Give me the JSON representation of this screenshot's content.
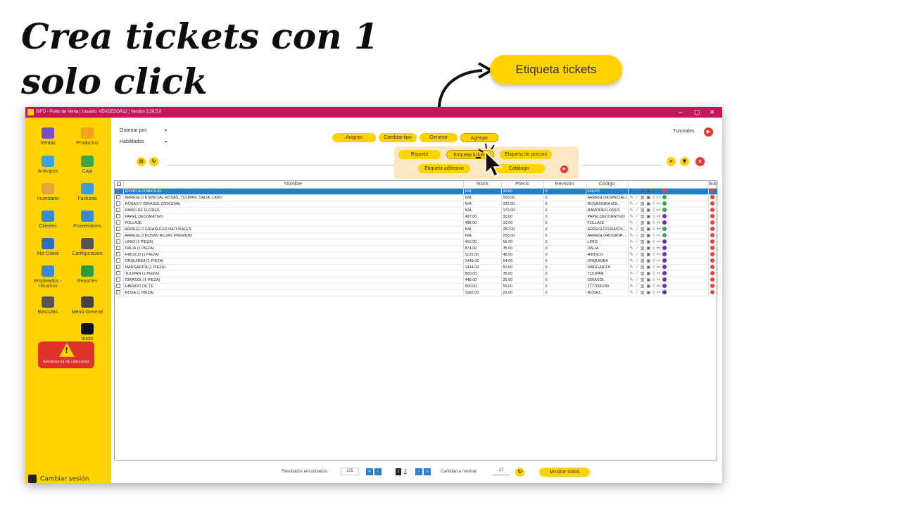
{
  "headline": "Crea tickets con 1 solo click",
  "callout": "Etiqueta tickets",
  "window": {
    "title": "SIFO - Punto de Venta    |  Usuario: VENDEDOR12 | Versión 3.20.5.0",
    "controls": [
      "–",
      "▢",
      "✕"
    ]
  },
  "sidebar": {
    "items": [
      {
        "label": "Ventas",
        "icon": "cash-register-icon",
        "color": "#7a4fc9"
      },
      {
        "label": "Productos",
        "icon": "box-icon",
        "color": "#f2a516"
      },
      {
        "label": "Anticipos",
        "icon": "money-hand-icon",
        "color": "#3aa3d8"
      },
      {
        "label": "Caja",
        "icon": "cash-icon",
        "color": "#3aa648"
      },
      {
        "label": "Inventario",
        "icon": "boxes-icon",
        "color": "#e8a33b"
      },
      {
        "label": "Facturas",
        "icon": "invoice-icon",
        "color": "#3d9ad8"
      },
      {
        "label": "Clientes",
        "icon": "client-icon",
        "color": "#3a8ad0"
      },
      {
        "label": "Proveedores",
        "icon": "truck-icon",
        "color": "#3a8ad0"
      },
      {
        "label": "Mis Datos",
        "icon": "user-icon",
        "color": "#2f6fc0"
      },
      {
        "label": "Configuración",
        "icon": "gear-icon",
        "color": "#555555"
      },
      {
        "label": "Empleados - Usuarios",
        "icon": "team-icon",
        "color": "#3a8ad0"
      },
      {
        "label": "Reportes",
        "icon": "chart-icon",
        "color": "#2c9b44"
      },
      {
        "label": "Básculas",
        "icon": "scale-icon",
        "color": "#555555"
      },
      {
        "label": "Menú General",
        "icon": "menu-icon",
        "color": "#444444"
      },
      {
        "label": "Inicio",
        "icon": "home-icon",
        "color": "#111111"
      }
    ],
    "warning": "Advertencia de caducidad",
    "logout": "Cambiar sesión"
  },
  "toolbar": {
    "ordenar": "Ordenar por:",
    "habilitados": "Habilitados",
    "asignar": "Asignar",
    "cambiar_tipo": "Cambiar tipo",
    "generar": "Generar",
    "agregar": "Agregar",
    "tutoriales": "Tutoriales"
  },
  "dropdown": {
    "reporte": "Reporte",
    "etiqueta_tickets": "Etiqueta tickets",
    "etiqueta_precios": "Etiqueta de precios",
    "etiqueta_adhesiva": "Etiqueta adhesiva",
    "catalogo": "Catálogo"
  },
  "table": {
    "headers": [
      "",
      "Nombre",
      "Stock",
      "Precio",
      "Revisión",
      "Código",
      "",
      "Sub"
    ],
    "rows": [
      {
        "nombre": "ENVIO A DOMICILIO",
        "stock": "N/A",
        "precio": "30.00",
        "revision": "0",
        "codigo": "ENVIO",
        "dot": "#e8423a",
        "tag": "#e8423a"
      },
      {
        "nombre": "ARREGLO ESPECIAL ROSAS, TULIPAN, DALIA, LIRIO",
        "stock": "N/A",
        "precio": "500.00",
        "revision": "0",
        "codigo": "ARREGLOESPECIAL1",
        "dot": "#e8423a",
        "tag": "#2fa84f"
      },
      {
        "nombre": "ROSAS Y GIRASOL (DOCENA)",
        "stock": "N/A",
        "precio": "322.00",
        "revision": "0",
        "codigo": "ROSASGIRASOL",
        "dot": "#e8423a",
        "tag": "#2fa84f"
      },
      {
        "nombre": "RAMO DE FLORES",
        "stock": "N/A",
        "precio": "170.00",
        "revision": "0",
        "codigo": "RAMODEFLORES",
        "dot": "#e8423a",
        "tag": "#2fa84f"
      },
      {
        "nombre": "PAPEL DECORATIVO",
        "stock": "497.00",
        "precio": "30.00",
        "revision": "0",
        "codigo": "PAPELDECORATIVO",
        "dot": "#e8423a",
        "tag": "#6a2fb0"
      },
      {
        "nombre": "FOLLAJE",
        "stock": "498.00",
        "precio": "10.00",
        "revision": "0",
        "codigo": "FOLLAJE",
        "dot": "#e8423a",
        "tag": "#6a2fb0"
      },
      {
        "nombre": "ARREGLO GIRASOLES NATURALES",
        "stock": "N/A",
        "precio": "250.00",
        "revision": "0",
        "codigo": "ARREGLOGIRASOL...",
        "dot": "#e8423a",
        "tag": "#2fa84f"
      },
      {
        "nombre": "ARREGLO ROSAS ROJAS PREMIUM",
        "stock": "N/A",
        "precio": "250.00",
        "revision": "0",
        "codigo": "ARREGLOROSASR...",
        "dot": "#e8423a",
        "tag": "#2fa84f"
      },
      {
        "nombre": "LIRIO (1 PIEZA)",
        "stock": "450.00",
        "precio": "55.00",
        "revision": "0",
        "codigo": "LIRIO",
        "dot": "#e8423a",
        "tag": "#6a2fb0"
      },
      {
        "nombre": "DALIA (1 PIEZA)",
        "stock": "874.00",
        "precio": "35.00",
        "revision": "0",
        "codigo": "DALIA",
        "dot": "#e8423a",
        "tag": "#6a2fb0"
      },
      {
        "nombre": "HIBISCO (1 PIEZA)",
        "stock": "1125.00",
        "precio": "48.00",
        "revision": "0",
        "codigo": "HIBISCO",
        "dot": "#e8423a",
        "tag": "#6a2fb0"
      },
      {
        "nombre": "ORQUIDEA (1 PIEZA)",
        "stock": "1445.00",
        "precio": "54.00",
        "revision": "0",
        "codigo": "ORQUIDEA",
        "dot": "#e8423a",
        "tag": "#6a2fb0"
      },
      {
        "nombre": "MARGARITA (1 PIEZA)",
        "stock": "1444.00",
        "precio": "50.00",
        "revision": "0",
        "codigo": "MARGARITA",
        "dot": "#e8423a",
        "tag": "#6a2fb0"
      },
      {
        "nombre": "TULIPAN (1 PIEZA)",
        "stock": "900.00",
        "precio": "35.00",
        "revision": "0",
        "codigo": "TULIPAN",
        "dot": "#e8423a",
        "tag": "#6a2fb0"
      },
      {
        "nombre": "GIRASOL (1 PIEZA)",
        "stock": "448.00",
        "precio": "25.00",
        "revision": "0",
        "codigo": "GIRASOL",
        "dot": "#e8423a",
        "tag": "#6a2fb0"
      },
      {
        "nombre": "HIBRIDO DE TE",
        "stock": "650.00",
        "precio": "55.00",
        "revision": "0",
        "codigo": "7777000240",
        "dot": "#e8423a",
        "tag": "#6a2fb0"
      },
      {
        "nombre": "ROSA (1 PIEZA)",
        "stock": "1062.00",
        "precio": "25.00",
        "revision": "0",
        "codigo": "ROSA1",
        "dot": "#e8423a",
        "tag": "#6a2fb0"
      }
    ]
  },
  "footer": {
    "resultados_label": "Resultados encontrados:",
    "resultados": "225",
    "page_current": "1",
    "page_next": "2",
    "cantidad_label": "Cantidad a mostrar:",
    "cantidad": "17",
    "mostrar_todos": "Mostrar todos"
  }
}
